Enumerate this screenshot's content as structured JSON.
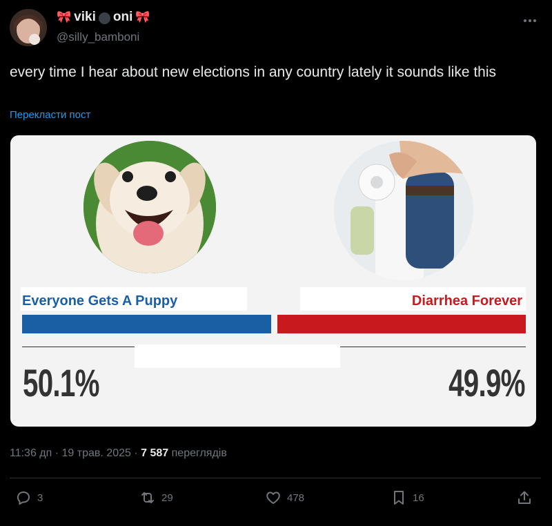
{
  "user": {
    "name_part1": "viki",
    "name_part2": "oni",
    "handle": "@silly_bamboni"
  },
  "tweet": {
    "text": "every time I hear about new elections in any country lately it sounds like this",
    "translate_label": "Перекласти пост",
    "time": "11:36 дп",
    "date": "19 трав. 2025",
    "views_count": "7 587",
    "views_label": "переглядів"
  },
  "poll_image": {
    "left_label": "Everyone Gets A Puppy",
    "right_label": "Diarrhea Forever",
    "left_pct": "50.1%",
    "right_pct": "49.9%",
    "left_share": 50.1,
    "right_share": 49.9,
    "left_color": "#1a5fa3",
    "right_color": "#c8191f"
  },
  "actions": {
    "replies": "3",
    "reposts": "29",
    "likes": "478",
    "bookmarks": "16"
  },
  "icons": {
    "name_decorations": [
      "ribbon-icon",
      "bomb-icon",
      "ribbon-icon"
    ],
    "more": "more-icon",
    "reply": "reply-icon",
    "repost": "repost-icon",
    "like": "heart-icon",
    "bookmark": "bookmark-icon",
    "share": "share-icon"
  },
  "colors": {
    "background": "#000000",
    "link": "#1d9bf0",
    "muted": "#71767b",
    "text": "#e7e9ea"
  }
}
